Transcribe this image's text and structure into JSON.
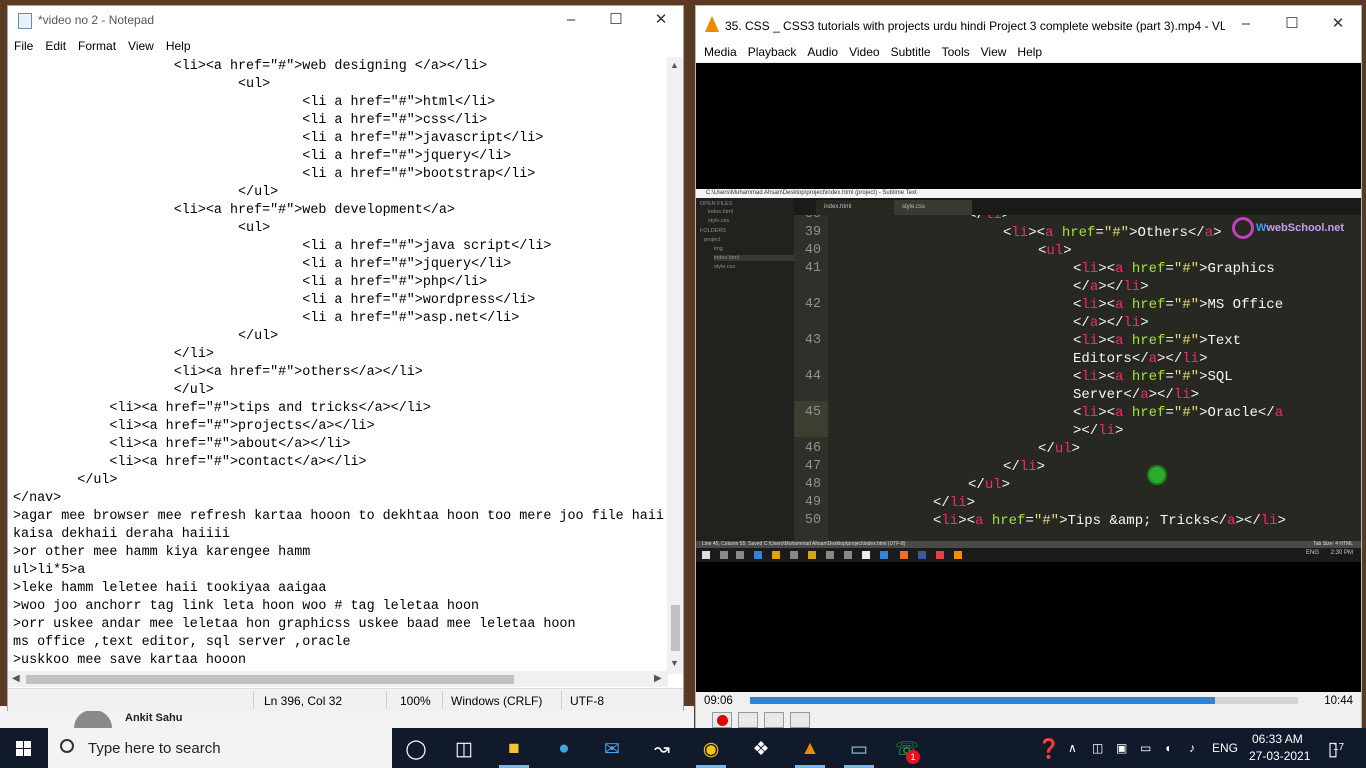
{
  "notepad": {
    "title": "*video no 2 - Notepad",
    "menu": [
      "File",
      "Edit",
      "Format",
      "View",
      "Help"
    ],
    "content": "                    <li><a href=\"#\">web designing </a></li>\n                            <ul>\n                                    <li a href=\"#\">html</li>\n                                    <li a href=\"#\">css</li>\n                                    <li a href=\"#\">javascript</li>\n                                    <li a href=\"#\">jquery</li>\n                                    <li a href=\"#\">bootstrap</li>\n                            </ul>\n                    <li><a href=\"#\">web development</a>\n                            <ul>\n                                    <li a href=\"#\">java script</li>\n                                    <li a href=\"#\">jquery</li>\n                                    <li a href=\"#\">php</li>\n                                    <li a href=\"#\">wordpress</li>\n                                    <li a href=\"#\">asp.net</li>\n                            </ul>\n                    </li>\n                    <li><a href=\"#\">others</a></li>\n                    </ul>\n            <li><a href=\"#\">tips and tricks</a></li>\n            <li><a href=\"#\">projects</a></li>\n            <li><a href=\"#\">about</a></li>\n            <li><a href=\"#\">contact</a></li>\n        </ul>\n</nav>\n>agar mee browser mee refresh kartaa hooon to dekhtaa hoon too mere joo file haii\nkaisa dekhaii deraha haiiii\n>or other mee hamm kiya karengee hamm\nul>li*5>a\n>leke hamm leletee haii tookiyaa aaigaa\n>woo joo anchorr tag link leta hoon woo # tag leletaa hoon\n>orr uskee andar mee leletaa hon graphicss uskee baad mee leletaa hoon\nms office ,text editor, sql server ,oracle\n>uskkoo mee save kartaa hooon",
    "status": {
      "position": "Ln 396, Col 32",
      "zoom": "100%",
      "line_ending": "Windows (CRLF)",
      "encoding": "UTF-8"
    }
  },
  "desktop": {
    "behind_name": "Ankit Sahu"
  },
  "vlc": {
    "title": "35. CSS _ CSS3 tutorials with projects urdu hindi Project 3 complete website (part 3).mp4 - VL...",
    "menu": [
      "Media",
      "Playback",
      "Audio",
      "Video",
      "Subtitle",
      "Tools",
      "View",
      "Help"
    ],
    "elapsed": "09:06",
    "total": "10:44",
    "progress": 0.8478
  },
  "video_frame": {
    "window_title": "C:\\Users\\Muhammad Ahsan\\Desktop\\project\\index.html (project) - Sublime Text",
    "sidebar": {
      "open_files_label": "OPEN FILES",
      "open_files": [
        "index.html",
        "style.css"
      ],
      "folders_label": "FOLDERS",
      "folder": "project",
      "items": [
        "img",
        "index.html",
        "style.css"
      ]
    },
    "tabs": [
      "index.html",
      "style.css"
    ],
    "logo": {
      "prefix": "W",
      "brand": "webSchool.net"
    },
    "line_numbers": [
      "38",
      "39",
      "40",
      "41",
      "42",
      "43",
      "44",
      "45",
      "46",
      "47",
      "48",
      "49",
      "50"
    ],
    "code_lines": [
      {
        "indent": 0,
        "parts": [
          "</li>"
        ]
      },
      {
        "indent": 1,
        "parts": [
          "<li><a href=\"#\">Others</a>"
        ]
      },
      {
        "indent": 2,
        "parts": [
          "<ul>"
        ]
      },
      {
        "indent": 3,
        "parts": [
          "<li><a href=\"#\">Graphics",
          "</a></li>"
        ]
      },
      {
        "indent": 3,
        "parts": [
          "<li><a href=\"#\">MS Office",
          "</a></li>"
        ]
      },
      {
        "indent": 3,
        "parts": [
          "<li><a href=\"#\">Text",
          "Editors</a></li>"
        ]
      },
      {
        "indent": 3,
        "parts": [
          "<li><a href=\"#\">SQL",
          "Server</a></li>"
        ]
      },
      {
        "indent": 3,
        "parts": [
          "<li><a href=\"#\">Oracle</a",
          "></li>"
        ]
      },
      {
        "indent": 2,
        "parts": [
          "</ul>"
        ]
      },
      {
        "indent": 1,
        "parts": [
          "</li>"
        ]
      },
      {
        "indent": 0,
        "parts": [
          "</ul>"
        ]
      },
      {
        "indent": -1,
        "parts": [
          "</li>"
        ]
      },
      {
        "indent": -1,
        "parts": [
          "<li><a href=\"#\">Tips &amp; Tricks</a></li>"
        ]
      }
    ],
    "statusbar": "Line 45, Column 55; Saved C:\\Users\\Muhammad Ahsan\\Desktop\\project\\index.html (UTF-8)",
    "statusbar_right": "Tab Size: 4     HTML",
    "taskbar_time": "2:30 PM",
    "taskbar_lang": "ENG"
  },
  "taskbar": {
    "search_placeholder": "Type here to search",
    "language": "ENG",
    "time": "06:33 AM",
    "date": "27-03-2021",
    "notification_count": "17",
    "whatsapp_badge": "1",
    "accent": "#76b9ed"
  }
}
